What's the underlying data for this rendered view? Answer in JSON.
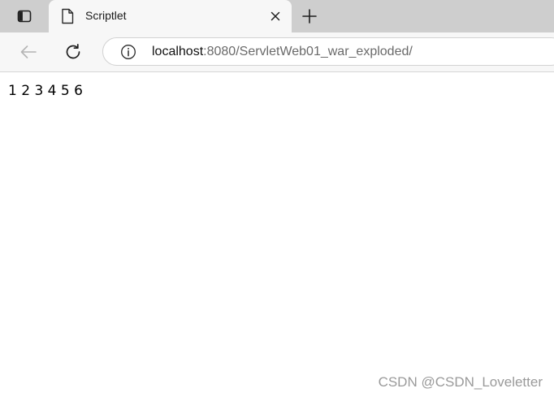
{
  "tabstrip": {
    "tab_actions_icon": "tab-actions-icon",
    "active_tab": {
      "favicon": "page-icon",
      "title": "Scriptlet",
      "close_icon": "close-icon"
    },
    "new_tab_icon": "plus-icon"
  },
  "toolbar": {
    "back_icon": "back-arrow-icon",
    "reload_icon": "reload-icon",
    "address": {
      "info_icon": "info-icon",
      "host": "localhost",
      "rest": ":8080/ServletWeb01_war_exploded/"
    }
  },
  "page": {
    "numbers_text": "1 2 3 4 5 6"
  },
  "watermark": {
    "text": "CSDN @CSDN_Loveletter"
  },
  "colors": {
    "tabstrip_bg": "#cecece",
    "toolbar_bg": "#f7f7f7",
    "page_bg": "#ffffff",
    "url_secondary": "#6a6a6a"
  }
}
